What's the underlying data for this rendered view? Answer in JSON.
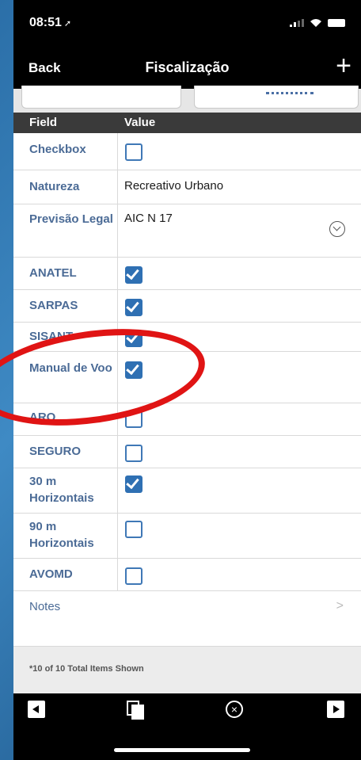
{
  "status": {
    "time": "08:51",
    "location_arrow": "➚"
  },
  "nav": {
    "back": "Back",
    "title": "Fiscalização",
    "add": "+"
  },
  "table": {
    "header_field": "Field",
    "header_value": "Value",
    "rows": [
      {
        "label": "Checkbox",
        "type": "checkbox",
        "checked": false
      },
      {
        "label": "Natureza",
        "type": "text",
        "value": "Recreativo Urbano"
      },
      {
        "label": "Previsão Legal",
        "type": "select",
        "value": "AIC N 17"
      },
      {
        "label": "ANATEL",
        "type": "checkbox",
        "checked": true
      },
      {
        "label": "SARPAS",
        "type": "checkbox",
        "checked": true
      },
      {
        "label": "SISANT",
        "type": "checkbox",
        "checked": true
      },
      {
        "label": "Manual de Voo",
        "type": "checkbox",
        "checked": true
      },
      {
        "label": "ARO",
        "type": "checkbox",
        "checked": false
      },
      {
        "label": "SEGURO",
        "type": "checkbox",
        "checked": false
      },
      {
        "label": "30 m Horizontais",
        "type": "checkbox",
        "checked": true
      },
      {
        "label": "90 m Horizontais",
        "type": "checkbox",
        "checked": false
      },
      {
        "label": "AVOMD",
        "type": "checkbox",
        "checked": false
      },
      {
        "label": "Notes",
        "type": "link",
        "chevron": ">"
      }
    ]
  },
  "footer": {
    "note": "*10 of 10 Total Items Shown"
  },
  "toolbar": {
    "icons": [
      "previous-record-icon",
      "copy-record-icon",
      "close-circle-icon",
      "next-record-icon"
    ],
    "close_glyph": "×"
  },
  "colors": {
    "accent": "#2f70b3",
    "label": "#4b6b96",
    "annotation": "#e01414"
  }
}
